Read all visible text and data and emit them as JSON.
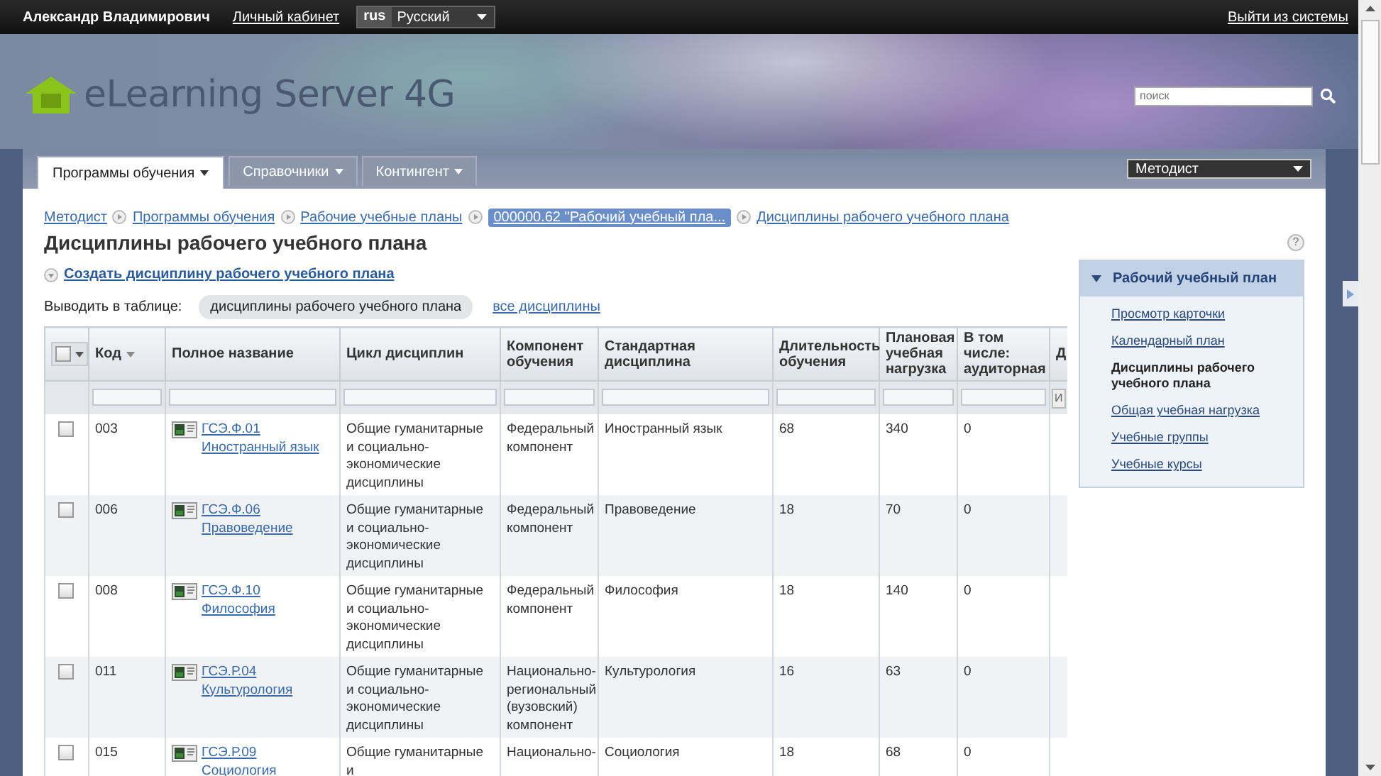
{
  "top_bar": {
    "user": "Александр Владимирович",
    "cabinet_link": "Личный кабинет",
    "language": {
      "code": "rus",
      "value": "Русский"
    },
    "logout_link": "Выйти из системы"
  },
  "header": {
    "logo_text": "eLearning Server 4G",
    "search": {
      "placeholder": "поиск"
    }
  },
  "nav": {
    "tabs": [
      {
        "label": "Программы обучения",
        "selected": true
      },
      {
        "label": "Справочники",
        "selected": false
      },
      {
        "label": "Контингент",
        "selected": false
      }
    ],
    "role_select": {
      "value": "Методист"
    }
  },
  "breadcrumbs": [
    {
      "label": "Методист",
      "highlighted": false
    },
    {
      "label": "Программы обучения",
      "highlighted": false
    },
    {
      "label": "Рабочие учебные планы",
      "highlighted": false
    },
    {
      "label": "000000.62 \"Рабочий учебный пла...",
      "highlighted": true
    },
    {
      "label": "Дисциплины рабочего учебного плана",
      "highlighted": false
    }
  ],
  "page_title": "Дисциплины рабочего учебного плана",
  "help_button": "?",
  "create_link": "Создать дисциплину рабочего учебного плана",
  "display_filter": {
    "label": "Выводить в таблице:",
    "options": [
      {
        "label": "дисциплины рабочего учебного плана",
        "selected": true
      },
      {
        "label": "все дисциплины",
        "selected": false
      }
    ]
  },
  "table": {
    "select_all_checked": false,
    "columns": [
      {
        "label": "Код",
        "sorted": true
      },
      {
        "label": "Полное название",
        "sorted": false
      },
      {
        "label": "Цикл дисциплин",
        "sorted": false
      },
      {
        "label": "Компонент обучения",
        "sorted": false
      },
      {
        "label": "Стандартная дисциплина",
        "sorted": false
      },
      {
        "label": "Длительность обучения",
        "sorted": false
      },
      {
        "label": "Плановая учебная нагрузка",
        "sorted": false
      },
      {
        "label": "В том числе: аудиторная",
        "sorted": false
      },
      {
        "label": "Д",
        "sorted": false
      }
    ],
    "filter_button": "И",
    "rows": [
      {
        "checked": false,
        "code": "003",
        "name": "ГСЭ.Ф.01 Иностранный язык",
        "cycle": "Общие гуманитарные и социально-экономические дисциплины",
        "component": "Федеральный компонент",
        "standard": "Иностранный язык",
        "duration": "68",
        "load": "340",
        "classroom": "0"
      },
      {
        "checked": false,
        "code": "006",
        "name": "ГСЭ.Ф.06 Правоведение",
        "cycle": "Общие гуманитарные и социально-экономические дисциплины",
        "component": "Федеральный компонент",
        "standard": "Правоведение",
        "duration": "18",
        "load": "70",
        "classroom": "0"
      },
      {
        "checked": false,
        "code": "008",
        "name": "ГСЭ.Ф.10 Философия",
        "cycle": "Общие гуманитарные и социально-экономические дисциплины",
        "component": "Федеральный компонент",
        "standard": "Философия",
        "duration": "18",
        "load": "140",
        "classroom": "0"
      },
      {
        "checked": false,
        "code": "011",
        "name": "ГСЭ.Р.04 Культурология",
        "cycle": "Общие гуманитарные и социально-экономические дисциплины",
        "component": "Национально-региональный (вузовский) компонент",
        "standard": "Культурология",
        "duration": "16",
        "load": "63",
        "classroom": "0"
      },
      {
        "checked": false,
        "code": "015",
        "name": "ГСЭ.Р.09 Социология",
        "cycle": "Общие гуманитарные и",
        "component": "Национально-",
        "standard": "Социология",
        "duration": "18",
        "load": "68",
        "classroom": "0"
      }
    ]
  },
  "sidebar": {
    "title": "Рабочий учебный план",
    "expanded": true,
    "items": [
      {
        "label": "Просмотр карточки",
        "selected": false
      },
      {
        "label": "Календарный план",
        "selected": false
      },
      {
        "label": "Дисциплины рабочего учебного плана",
        "selected": true
      },
      {
        "label": "Общая учебная нагрузка",
        "selected": false
      },
      {
        "label": "Учебные группы",
        "selected": false
      },
      {
        "label": "Учебные курсы",
        "selected": false
      }
    ]
  }
}
